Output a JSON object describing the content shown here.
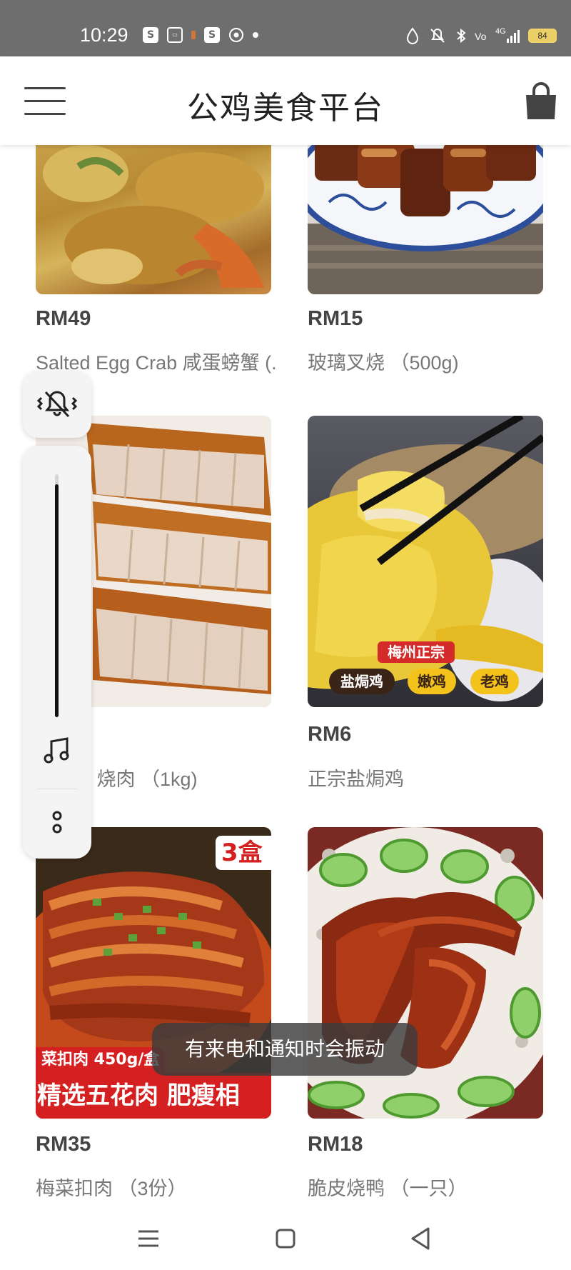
{
  "status_bar": {
    "time": "10:29",
    "network": "4G",
    "battery": "84"
  },
  "header": {
    "title": "公鸡美食平台"
  },
  "products": [
    {
      "price": "RM49",
      "name": "Salted Egg Crab 咸蛋螃蟹 (...",
      "image": "salted-egg-crab"
    },
    {
      "price": "RM15",
      "name": "玻璃叉烧 （500g)",
      "image": "char-siu"
    },
    {
      "price": "",
      "name": "d Pork 烧肉 （1kg)",
      "image": "roast-pork"
    },
    {
      "price": "RM6",
      "name": "正宗盐焗鸡",
      "image": "salt-baked-chicken",
      "tags": {
        "top": "梅州正宗",
        "t1": "盐焗鸡",
        "t2": "嫩鸡",
        "t3": "老鸡"
      }
    },
    {
      "price": "RM35",
      "name": "梅菜扣肉 （3份）",
      "image": "braised-pork-belly",
      "overlay": {
        "badge": "3盒",
        "line1": "菜扣肉 450g/盒",
        "line2": "精选五花肉 肥瘦相"
      }
    },
    {
      "price": "RM18",
      "name": "脆皮烧鸭 （一只）",
      "image": "roast-duck"
    }
  ],
  "volume": {
    "level": 0.96,
    "mode_icon": "vibrate-mute-icon",
    "stream_icon": "music-note-icon",
    "more_icon": "more-icon"
  },
  "toast": {
    "text": "有来电和通知时会振动"
  },
  "nav": {
    "menu_icon": "menu-icon",
    "home_icon": "home-icon",
    "back_icon": "back-icon"
  },
  "colors": {
    "status_bar": "#6e6e6e",
    "price": "#444444",
    "name": "#777777",
    "tag_red": "#d42a2a",
    "tag_dark": "#3a2418",
    "tag_yellow": "#f3c21b"
  }
}
